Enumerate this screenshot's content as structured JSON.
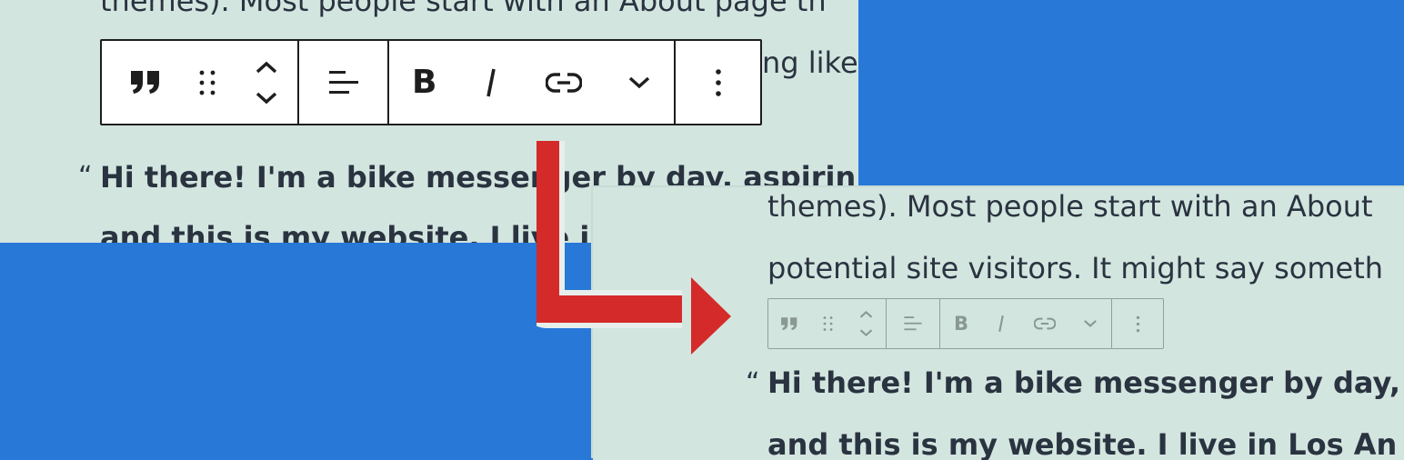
{
  "before": {
    "paragraph_line_1": "themes). Most people start with an About page th",
    "paragraph_line_2_fragment": "ng like",
    "quote_mark": "“",
    "quote_line_1": "Hi there! I'm a bike messenger by day, aspirin",
    "quote_line_2": "and this is my website. I live in"
  },
  "after": {
    "paragraph_line_1": "themes). Most people start with an About",
    "paragraph_line_2": "potential site visitors. It might say someth",
    "quote_mark": "“",
    "quote_line_1": "Hi there! I'm a bike messenger by day,",
    "quote_line_2": "and this is my website. I live in Los An"
  },
  "toolbar": {
    "icons": [
      "quote-icon",
      "drag-handle-icon",
      "move-up-down-icon",
      "align-left-icon",
      "bold-icon",
      "italic-icon",
      "link-icon",
      "chevron-down-icon",
      "more-options-icon"
    ],
    "bold_glyph": "B",
    "italic_glyph": "I"
  },
  "colors": {
    "background": "#2878d8",
    "panel": "#d3e5df",
    "text": "#2a3340",
    "arrow": "#d42a2a",
    "toolbar_border": "#1e1e1e",
    "muted_icon": "#8a9894"
  }
}
